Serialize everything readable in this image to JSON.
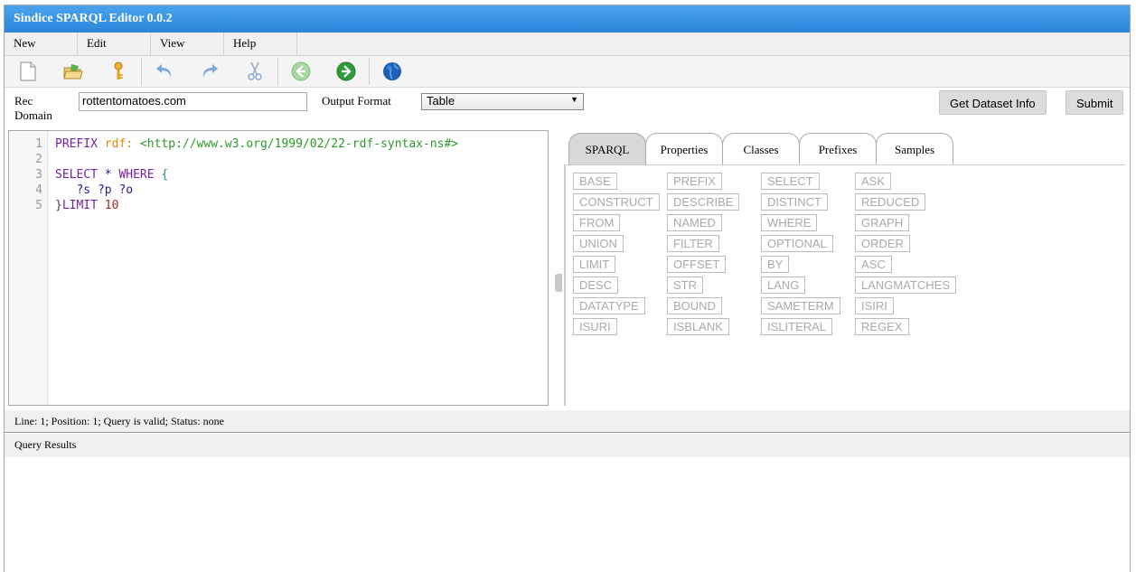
{
  "window": {
    "title": "Sindice SPARQL Editor 0.0.2"
  },
  "menu": [
    "New",
    "Edit",
    "View",
    "Help"
  ],
  "toolbar": {
    "buttons": [
      "new-file-icon",
      "open-folder-icon",
      "key-icon",
      "undo-icon",
      "redo-icon",
      "scissors-icon",
      "back-arrow-icon",
      "forward-arrow-icon",
      "globe-icon"
    ]
  },
  "form": {
    "rec_domain_label_1": "Rec",
    "rec_domain_label_2": "Domain",
    "rec_domain_value": "rottentomatoes.com",
    "output_format_label": "Output Format",
    "output_format_value": "Table",
    "get_dataset_info": "Get Dataset Info",
    "submit": "Submit"
  },
  "editor": {
    "line_numbers": [
      "1",
      "2",
      "3",
      "4",
      "5"
    ],
    "l1_kw": "PREFIX",
    "l1_prefix": "rdf:",
    "l1_iri": "<http://www.w3.org/1999/02/22-rdf-syntax-ns#>",
    "l3_kw": "SELECT",
    "l3_star": "*",
    "l3_where": "WHERE",
    "l3_brace": "{",
    "l4_vars": "?s ?p ?o",
    "l5_brace": "}",
    "l5_kw": "LIMIT",
    "l5_num": "10"
  },
  "tabs": [
    "SPARQL",
    "Properties",
    "Classes",
    "Prefixes",
    "Samples"
  ],
  "active_tab": "SPARQL",
  "keywords": [
    [
      "BASE",
      "PREFIX",
      "SELECT",
      "ASK"
    ],
    [
      "CONSTRUCT",
      "DESCRIBE",
      "DISTINCT",
      "REDUCED"
    ],
    [
      "FROM",
      "NAMED",
      "WHERE",
      "GRAPH"
    ],
    [
      "UNION",
      "FILTER",
      "OPTIONAL",
      "ORDER"
    ],
    [
      "LIMIT",
      "OFFSET",
      "BY",
      "ASC"
    ],
    [
      "DESC",
      "STR",
      "LANG",
      "LANGMATCHES"
    ],
    [
      "DATATYPE",
      "BOUND",
      "SAMETERM",
      "ISIRI"
    ],
    [
      "ISURI",
      "ISBLANK",
      "ISLITERAL",
      "REGEX"
    ]
  ],
  "status": {
    "text": "Line: 1; Position: 1; Query is valid; Status: none"
  },
  "results": {
    "title": "Query Results"
  },
  "colors": {
    "titlebar": "#3b95e6",
    "keyword_text": "#a9a9a9"
  }
}
